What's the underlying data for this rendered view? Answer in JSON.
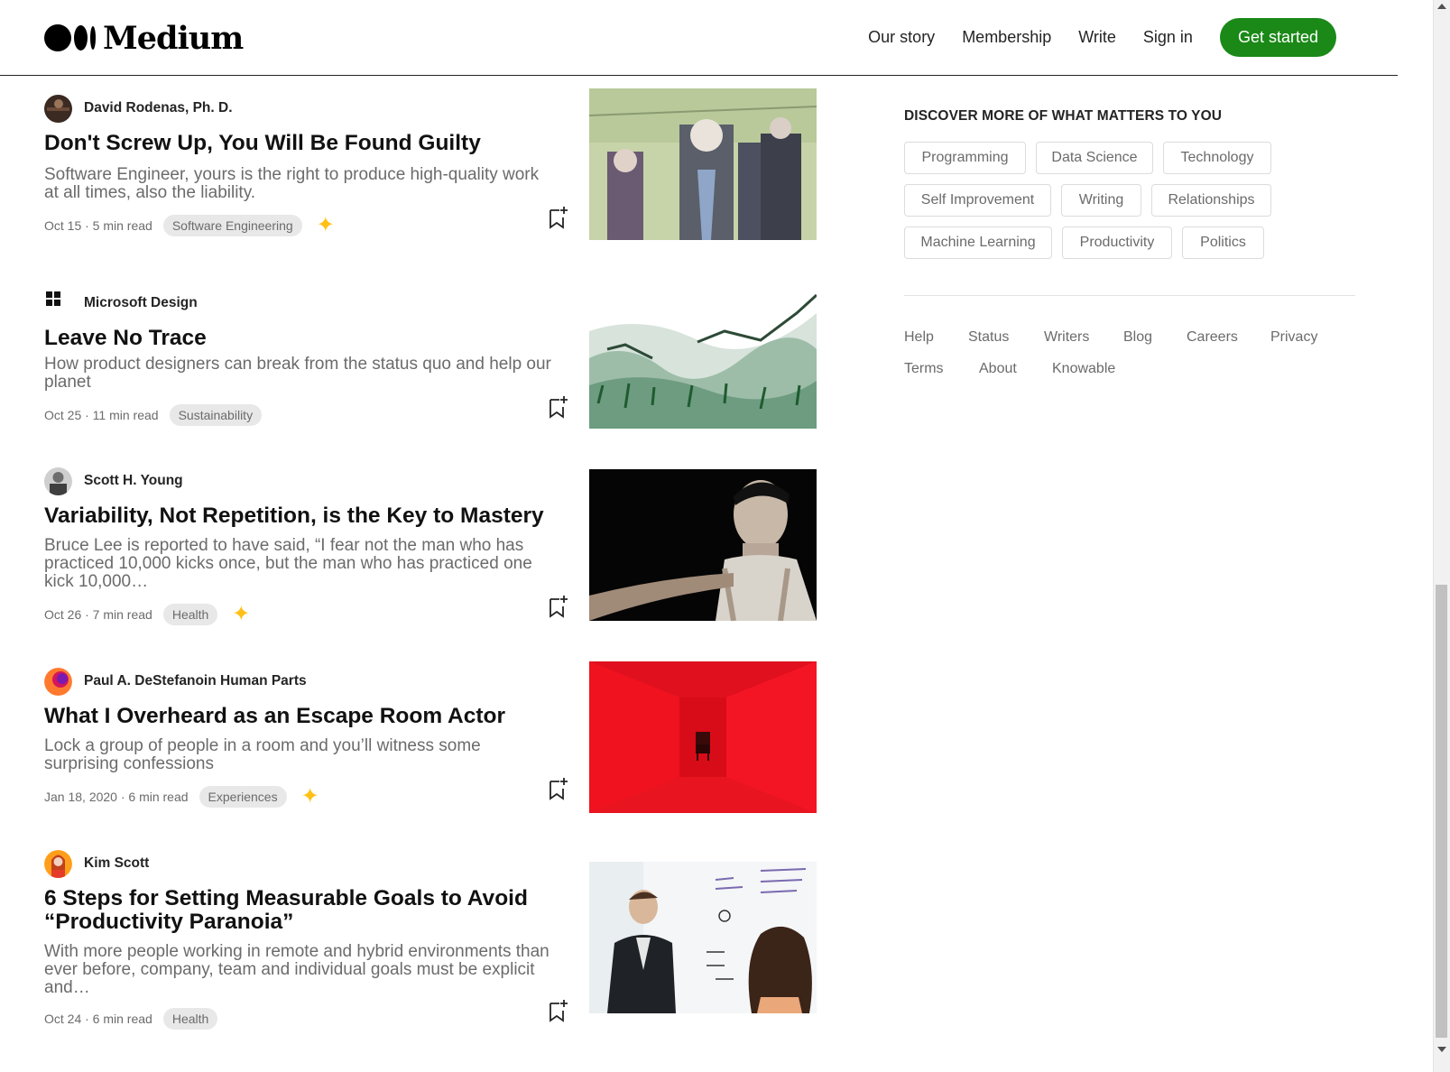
{
  "header": {
    "logo_text": "Medium",
    "nav": {
      "our_story": "Our story",
      "membership": "Membership",
      "write": "Write",
      "sign_in": "Sign in",
      "get_started": "Get started"
    }
  },
  "articles": [
    {
      "author": "David Rodenas, Ph. D.",
      "title": "Don't Screw Up, You Will Be Found Guilty",
      "subtitle": "Software Engineer, yours is the right to produce high-quality work at all times, also the liability.",
      "meta": "Oct 15 · 5 min read",
      "tag": "Software Engineering",
      "member_star": true
    },
    {
      "author": "Microsoft Design",
      "title": "Leave No Trace",
      "subtitle": "How product designers can break from the status quo and help our planet",
      "meta": "Oct 25 · 11 min read",
      "tag": "Sustainability",
      "member_star": false
    },
    {
      "author": "Scott H. Young",
      "title": "Variability, Not Repetition, is the Key to Mastery",
      "subtitle": "Bruce Lee is reported to have said, “I fear not the man who has practiced 10,000 kicks once, but the man who has practiced one kick 10,000…",
      "meta": "Oct 26 · 7 min read",
      "tag": "Health",
      "member_star": true
    },
    {
      "author": "Paul A. DeStefanoin Human Parts",
      "title": "What I Overheard as an Escape Room Actor",
      "subtitle": "Lock a group of people in a room and you’ll witness some surprising confessions",
      "meta": "Jan 18, 2020 · 6 min read",
      "tag": "Experiences",
      "member_star": true
    },
    {
      "author": "Kim Scott",
      "title": "6 Steps for Setting Measurable Goals to Avoid “Productivity Paranoia”",
      "subtitle": "With more people working in remote and hybrid environments than ever before, company, team and individual goals must be explicit and…",
      "meta": "Oct 24 · 6 min read",
      "tag": "Health",
      "member_star": false
    }
  ],
  "sidebar": {
    "heading": "DISCOVER MORE OF WHAT MATTERS TO YOU",
    "topics": [
      "Programming",
      "Data Science",
      "Technology",
      "Self Improvement",
      "Writing",
      "Relationships",
      "Machine Learning",
      "Productivity",
      "Politics"
    ],
    "footer_links": [
      "Help",
      "Status",
      "Writers",
      "Blog",
      "Careers",
      "Privacy",
      "Terms",
      "About",
      "Knowable"
    ]
  },
  "colors": {
    "accent_green": "#1a8917",
    "member_star": "#ffc017",
    "text_primary": "#242424",
    "text_secondary": "#6b6b6b"
  }
}
